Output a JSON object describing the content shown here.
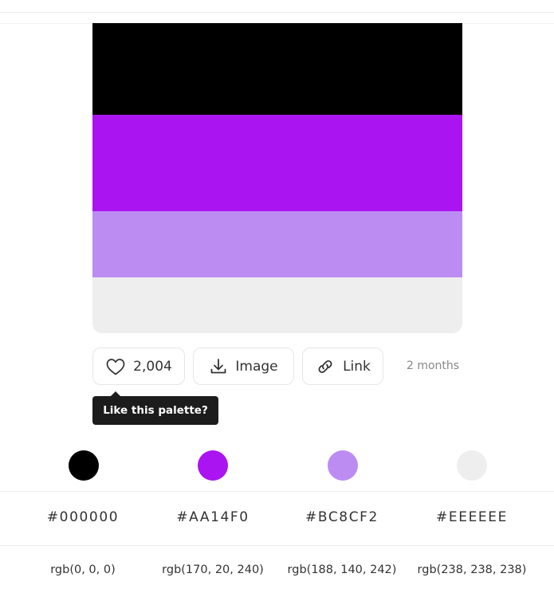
{
  "palette": {
    "colors": [
      {
        "hex_label": "#000000",
        "rgb_label": "rgb(0, 0, 0)",
        "color": "#000000"
      },
      {
        "hex_label": "#AA14F0",
        "rgb_label": "rgb(170, 20, 240)",
        "color": "#AA14F0"
      },
      {
        "hex_label": "#BC8CF2",
        "rgb_label": "rgb(188, 140, 242)",
        "color": "#BC8CF2"
      },
      {
        "hex_label": "#EEEEEE",
        "rgb_label": "rgb(238, 238, 238)",
        "color": "#EEEEEE"
      }
    ]
  },
  "actions": {
    "like_count": "2,004",
    "image_label": "Image",
    "link_label": "Link",
    "time_ago": "2 months"
  },
  "tooltip": {
    "text": "Like this palette?"
  },
  "icons": {
    "like": "heart-icon",
    "image": "download-icon",
    "link": "link-icon"
  }
}
